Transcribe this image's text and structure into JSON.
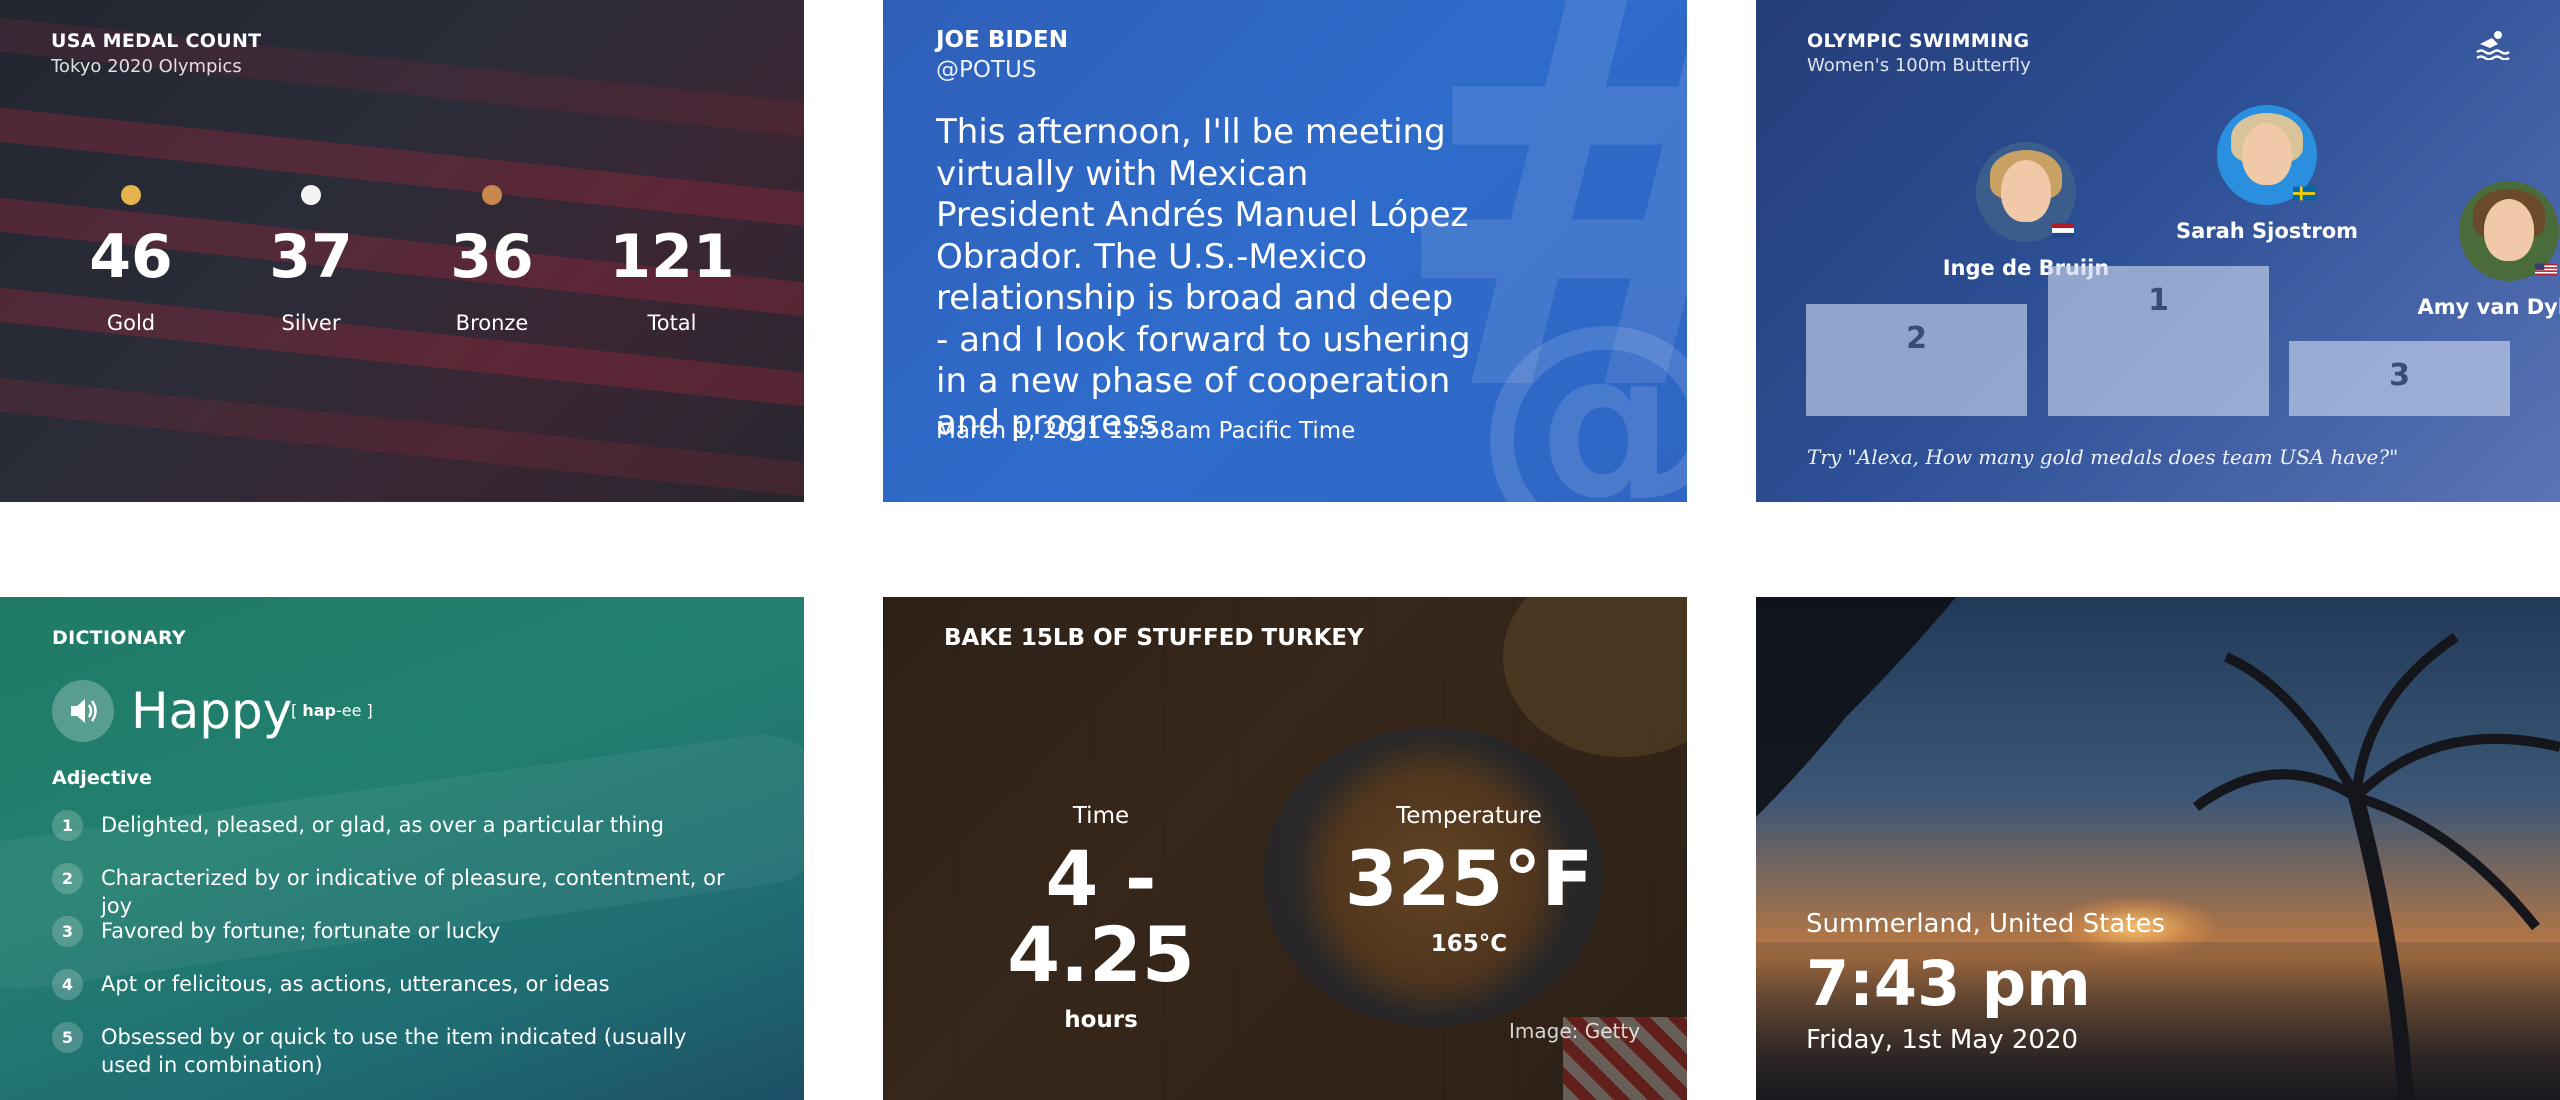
{
  "medals": {
    "kicker": "USA MEDAL COUNT",
    "subtitle": "Tokyo 2020 Olympics",
    "items": [
      {
        "value": "46",
        "label": "Gold",
        "color": "#e6b44c"
      },
      {
        "value": "37",
        "label": "Silver",
        "color": "#f4f4f4"
      },
      {
        "value": "36",
        "label": "Bronze",
        "color": "#c8874c"
      },
      {
        "value": "121",
        "label": "Total",
        "color": ""
      }
    ]
  },
  "tweet": {
    "author": "JOE BIDEN",
    "handle": "@POTUS",
    "text": "This afternoon, I'll be meeting virtually with Mexican President Andrés Manuel López Obrador. The U.S.-Mexico relationship is broad and deep - and I look forward to ushering in a new phase of cooperation and progress.",
    "date": "March 1, 2021 11:58am Pacific Time",
    "bg_glyph_1": "#",
    "bg_glyph_2": "@"
  },
  "swimming": {
    "kicker": "OLYMPIC SWIMMING",
    "subtitle": "Women's 100m Butterfly",
    "icon": "swimmer-icon",
    "podium": [
      {
        "place": "2",
        "name": "Inge de Bruijn",
        "flag": "netherlands"
      },
      {
        "place": "1",
        "name": "Sarah Sjostrom",
        "flag": "sweden"
      },
      {
        "place": "3",
        "name": "Amy van Dyken",
        "flag": "usa"
      }
    ],
    "hint": "Try \"Alexa, How many gold medals does team USA have?\""
  },
  "dictionary": {
    "kicker": "DICTIONARY",
    "word": "Happy",
    "pron_open": "[",
    "pron_stress": "hap",
    "pron_rest": "-ee",
    "pron_close": "]",
    "pos": "Adjective",
    "definitions": [
      {
        "n": "1",
        "text": "Delighted, pleased, or glad, as over a particular thing"
      },
      {
        "n": "2",
        "text": "Characterized by or indicative of pleasure, contentment, or joy"
      },
      {
        "n": "3",
        "text": "Favored by fortune; fortunate or lucky"
      },
      {
        "n": "4",
        "text": "Apt or felicitous, as actions, utterances, or ideas"
      },
      {
        "n": "5",
        "text": "Obsessed by or quick to use the item indicated (usually used in combination)"
      }
    ]
  },
  "turkey": {
    "title": "BAKE 15LB OF STUFFED TURKEY",
    "time_label": "Time",
    "time_value": "4 - 4.25",
    "time_unit": "hours",
    "temp_label": "Temperature",
    "temp_value": "325°F",
    "temp_alt": "165°C",
    "credit": "Image: Getty"
  },
  "clock": {
    "location": "Summerland, United States",
    "time": "7:43 pm",
    "date": "Friday, 1st May 2020"
  }
}
